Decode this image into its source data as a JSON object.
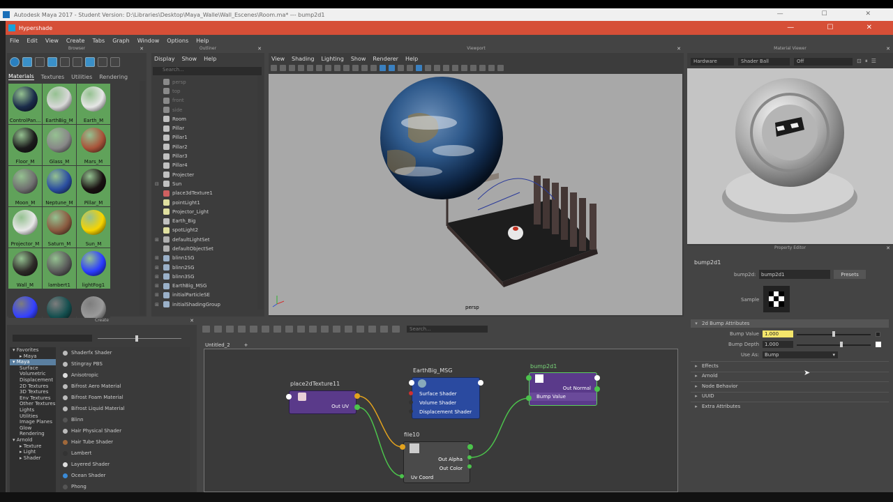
{
  "window": {
    "title": "Autodesk Maya 2017 - Student Version: D:\\Libraries\\Desktop\\Maya_Walle\\Wall_Escenes\\Room.ma*   ---   bump2d1"
  },
  "hypershade": {
    "title": "Hypershade",
    "menu": [
      "File",
      "Edit",
      "View",
      "Create",
      "Tabs",
      "Graph",
      "Window",
      "Options",
      "Help"
    ]
  },
  "browser": {
    "panel_title": "Browser",
    "tabs": [
      "Materials",
      "Textures",
      "Utilities",
      "Rendering"
    ],
    "materials": [
      {
        "name": "ControlPan...",
        "color": "#1b2c4a"
      },
      {
        "name": "EarthBig_M",
        "color": "#d8d8d8"
      },
      {
        "name": "Earth_M",
        "color": "#e6e6e6"
      },
      {
        "name": "Floor_M",
        "color": "#1c1c1c"
      },
      {
        "name": "Glass_M",
        "color": "#888888"
      },
      {
        "name": "Mars_M",
        "color": "#a8543a"
      },
      {
        "name": "Moon_M",
        "color": "#707070"
      },
      {
        "name": "Neptune_M",
        "color": "#2b4ea0"
      },
      {
        "name": "Pillar_M",
        "color": "#1a1212"
      },
      {
        "name": "Projector_M",
        "color": "#e8e8e8"
      },
      {
        "name": "Saturn_M",
        "color": "#8a5a40"
      },
      {
        "name": "Sun_M",
        "color": "#f7d400"
      },
      {
        "name": "Wall_M",
        "color": "#2e2a28"
      },
      {
        "name": "lambert1",
        "color": "#5a5a5a"
      },
      {
        "name": "lightFog1",
        "color": "#2a3cff"
      },
      {
        "name": "",
        "color": "#3340ff"
      },
      {
        "name": "",
        "color": "#144f4f"
      },
      {
        "name": "",
        "color": "#9a9a9a"
      }
    ]
  },
  "outliner": {
    "panel_title": "Outliner",
    "menu": [
      "Display",
      "Show",
      "Help"
    ],
    "search_placeholder": "Search...",
    "items": [
      {
        "label": "persp",
        "expander": "",
        "dim": true,
        "icon": "camera-icon"
      },
      {
        "label": "top",
        "expander": "",
        "dim": true,
        "icon": "camera-icon"
      },
      {
        "label": "front",
        "expander": "",
        "dim": true,
        "icon": "camera-icon"
      },
      {
        "label": "side",
        "expander": "",
        "dim": true,
        "icon": "camera-icon"
      },
      {
        "label": "Room",
        "expander": "",
        "dim": false,
        "icon": "transform-icon"
      },
      {
        "label": "Pillar",
        "expander": "",
        "dim": false,
        "icon": "transform-icon"
      },
      {
        "label": "Pillar1",
        "expander": "",
        "dim": false,
        "icon": "transform-icon"
      },
      {
        "label": "Pillar2",
        "expander": "",
        "dim": false,
        "icon": "transform-icon"
      },
      {
        "label": "Pillar3",
        "expander": "",
        "dim": false,
        "icon": "transform-icon"
      },
      {
        "label": "Pillar4",
        "expander": "",
        "dim": false,
        "icon": "transform-icon"
      },
      {
        "label": "Projecter",
        "expander": "",
        "dim": false,
        "icon": "transform-icon"
      },
      {
        "label": "Sun",
        "expander": "⊟",
        "dim": false,
        "icon": "transform-icon"
      },
      {
        "label": "place3dTexture1",
        "expander": "",
        "dim": false,
        "icon": "texture-icon"
      },
      {
        "label": "pointLight1",
        "expander": "",
        "dim": false,
        "icon": "light-icon"
      },
      {
        "label": "Projector_Light",
        "expander": "",
        "dim": false,
        "icon": "light-icon"
      },
      {
        "label": "Earth_Big",
        "expander": "",
        "dim": false,
        "icon": "transform-icon"
      },
      {
        "label": "spotLight2",
        "expander": "",
        "dim": false,
        "icon": "light-icon"
      },
      {
        "label": "defaultLightSet",
        "expander": "⊞",
        "dim": false,
        "icon": "set-icon"
      },
      {
        "label": "defaultObjectSet",
        "expander": "",
        "dim": false,
        "icon": "set-icon"
      },
      {
        "label": "blinn1SG",
        "expander": "⊞",
        "dim": false,
        "icon": "shading-group-icon"
      },
      {
        "label": "blinn2SG",
        "expander": "⊞",
        "dim": false,
        "icon": "shading-group-icon"
      },
      {
        "label": "blinn3SG",
        "expander": "⊞",
        "dim": false,
        "icon": "shading-group-icon"
      },
      {
        "label": "EarthBig_MSG",
        "expander": "⊞",
        "dim": false,
        "icon": "shading-group-icon"
      },
      {
        "label": "initialParticleSE",
        "expander": "⊞",
        "dim": false,
        "icon": "shading-group-icon"
      },
      {
        "label": "initialShadingGroup",
        "expander": "⊞",
        "dim": false,
        "icon": "shading-group-icon"
      }
    ]
  },
  "viewport": {
    "panel_title": "Viewport",
    "menu": [
      "View",
      "Shading",
      "Lighting",
      "Show",
      "Renderer",
      "Help"
    ],
    "camera_label": "persp"
  },
  "material_viewer": {
    "panel_title": "Material Viewer",
    "renderer": "Hardware",
    "shape": "Shader Ball",
    "environment": "Off"
  },
  "property_editor": {
    "panel_title": "Property Editor",
    "node_name": "bump2d1",
    "type_label": "bump2d:",
    "type_value": "bump2d1",
    "presets_label": "Presets",
    "sample_label": "Sample",
    "section_open": "2d Bump Attributes",
    "bump_value_label": "Bump Value",
    "bump_value": "1.000",
    "bump_depth_label": "Bump Depth",
    "bump_depth": "1.000",
    "use_as_label": "Use As:",
    "use_as": "Bump",
    "sections": [
      "Effects",
      "Arnold",
      "Node Behavior",
      "UUID",
      "Extra Attributes"
    ]
  },
  "create_panel": {
    "panel_title": "Create",
    "tree": [
      {
        "label": "Favorites",
        "indent": 0,
        "prefix": "▾ ",
        "selected": false
      },
      {
        "label": "Maya",
        "indent": 1,
        "prefix": "▸ ",
        "selected": false
      },
      {
        "label": "Maya",
        "indent": 0,
        "prefix": "▾ ",
        "selected": true
      },
      {
        "label": "Surface",
        "indent": 1,
        "prefix": "",
        "selected": false
      },
      {
        "label": "Volumetric",
        "indent": 1,
        "prefix": "",
        "selected": false
      },
      {
        "label": "Displacement",
        "indent": 1,
        "prefix": "",
        "selected": false
      },
      {
        "label": "2D Textures",
        "indent": 1,
        "prefix": "",
        "selected": false
      },
      {
        "label": "3D Textures",
        "indent": 1,
        "prefix": "",
        "selected": false
      },
      {
        "label": "Env Textures",
        "indent": 1,
        "prefix": "",
        "selected": false
      },
      {
        "label": "Other Textures",
        "indent": 1,
        "prefix": "",
        "selected": false
      },
      {
        "label": "Lights",
        "indent": 1,
        "prefix": "",
        "selected": false
      },
      {
        "label": "Utilities",
        "indent": 1,
        "prefix": "",
        "selected": false
      },
      {
        "label": "Image Planes",
        "indent": 1,
        "prefix": "",
        "selected": false
      },
      {
        "label": "Glow",
        "indent": 1,
        "prefix": "",
        "selected": false
      },
      {
        "label": "Rendering",
        "indent": 1,
        "prefix": "",
        "selected": false
      },
      {
        "label": "Arnold",
        "indent": 0,
        "prefix": "▾ ",
        "selected": false
      },
      {
        "label": "Texture",
        "indent": 1,
        "prefix": "▸ ",
        "selected": false
      },
      {
        "label": "Light",
        "indent": 1,
        "prefix": "▸ ",
        "selected": false
      },
      {
        "label": "Shader",
        "indent": 1,
        "prefix": "▸ ",
        "selected": false
      }
    ],
    "shaders": [
      {
        "label": "Shaderfx Shader",
        "color": "#bbbbbb"
      },
      {
        "label": "Stingray PBS",
        "color": "#bbbbbb"
      },
      {
        "label": "Anisotropic",
        "color": "#dddddd"
      },
      {
        "label": "Bifrost Aero Material",
        "color": "#bbbbbb"
      },
      {
        "label": "Bifrost Foam Material",
        "color": "#bbbbbb"
      },
      {
        "label": "Bifrost Liquid Material",
        "color": "#bbbbbb"
      },
      {
        "label": "Blinn",
        "color": "#555555"
      },
      {
        "label": "Hair Physical Shader",
        "color": "#bbbbbb"
      },
      {
        "label": "Hair Tube Shader",
        "color": "#a0683a"
      },
      {
        "label": "Lambert",
        "color": "#333333"
      },
      {
        "label": "Layered Shader",
        "color": "#dddddd"
      },
      {
        "label": "Ocean Shader",
        "color": "#3a8ad6"
      },
      {
        "label": "Phong",
        "color": "#555555"
      }
    ]
  },
  "node_editor": {
    "tab_label": "Untitled_2",
    "add_tab": "+",
    "search_placeholder": "Search...",
    "nodes": {
      "place2d": {
        "title": "place2dTexture11",
        "out": "Out UV"
      },
      "shader": {
        "title": "EarthBig_MSG",
        "rows": [
          "Surface Shader",
          "Volume Shader",
          "Displacement Shader"
        ]
      },
      "bump": {
        "title": "bump2d1",
        "out": "Out Normal",
        "in": "Bump Value"
      },
      "file": {
        "title": "file10",
        "rows": [
          "Out Alpha",
          "Out Color",
          "Uv Coord"
        ]
      }
    }
  }
}
